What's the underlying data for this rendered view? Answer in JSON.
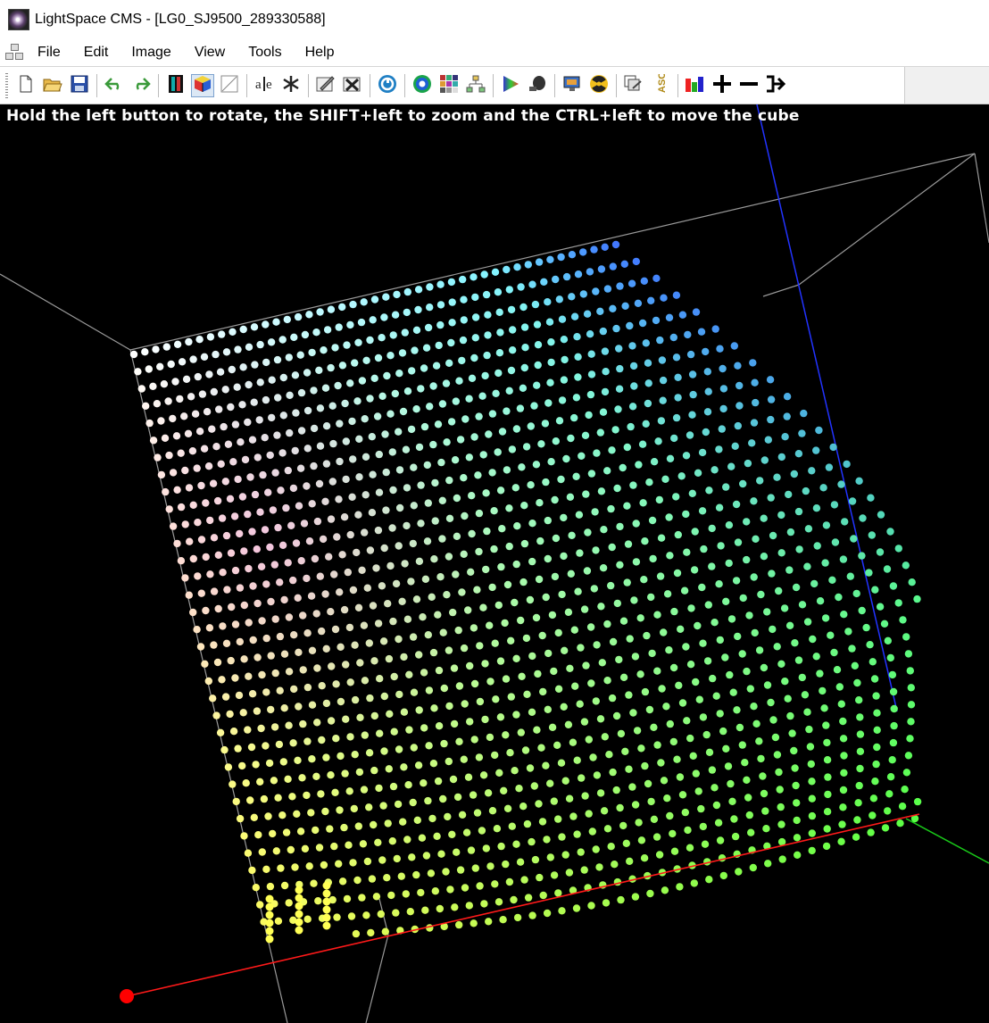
{
  "window": {
    "title": "LightSpace CMS - [LG0_SJ9500_289330588]"
  },
  "menu": {
    "items": [
      "File",
      "Edit",
      "Image",
      "View",
      "Tools",
      "Help"
    ]
  },
  "toolbar": {
    "buttons": [
      {
        "icon": "new-document-icon",
        "group": 1
      },
      {
        "icon": "open-folder-icon",
        "group": 1
      },
      {
        "icon": "save-disk-icon",
        "group": 1
      },
      {
        "icon": "undo-icon",
        "group": 2
      },
      {
        "icon": "redo-icon",
        "group": 2
      },
      {
        "icon": "film-strip-icon",
        "group": 3
      },
      {
        "icon": "color-cube-icon",
        "group": 3,
        "pressed": true
      },
      {
        "icon": "diagonal-graph-icon",
        "group": 3
      },
      {
        "icon": "text-script-icon",
        "group": 4
      },
      {
        "icon": "snowflake-icon",
        "group": 4
      },
      {
        "icon": "edit-image-icon",
        "group": 5
      },
      {
        "icon": "close-image-icon",
        "group": 5
      },
      {
        "icon": "info-circle-icon",
        "group": 6
      },
      {
        "icon": "target-ring-icon",
        "group": 7
      },
      {
        "icon": "color-grid-icon",
        "group": 7
      },
      {
        "icon": "network-tree-icon",
        "group": 7
      },
      {
        "icon": "color-triangle-icon",
        "group": 8
      },
      {
        "icon": "probe-icon",
        "group": 8
      },
      {
        "icon": "display-icon",
        "group": 9
      },
      {
        "icon": "radiation-icon",
        "group": 9
      },
      {
        "icon": "copy-layers-icon",
        "group": 10
      },
      {
        "icon": "asc-icon",
        "label": "ASC",
        "group": 10
      },
      {
        "icon": "rgb-bars-icon",
        "group": 11
      },
      {
        "icon": "plus-icon",
        "group": 11
      },
      {
        "icon": "minus-icon",
        "group": 11
      },
      {
        "icon": "export-arrow-icon",
        "group": 11
      }
    ]
  },
  "viewport": {
    "hint": "Hold the left button to rotate, the SHIFT+left to zoom and the CTRL+left to move the cube",
    "colors": {
      "background": "#000000",
      "cube_edges": "#9a9a9a",
      "red_axis": "#ff1a1a",
      "green_axis": "#19c819",
      "blue_axis": "#2233ff",
      "origin_marker": "#ff0000"
    }
  }
}
